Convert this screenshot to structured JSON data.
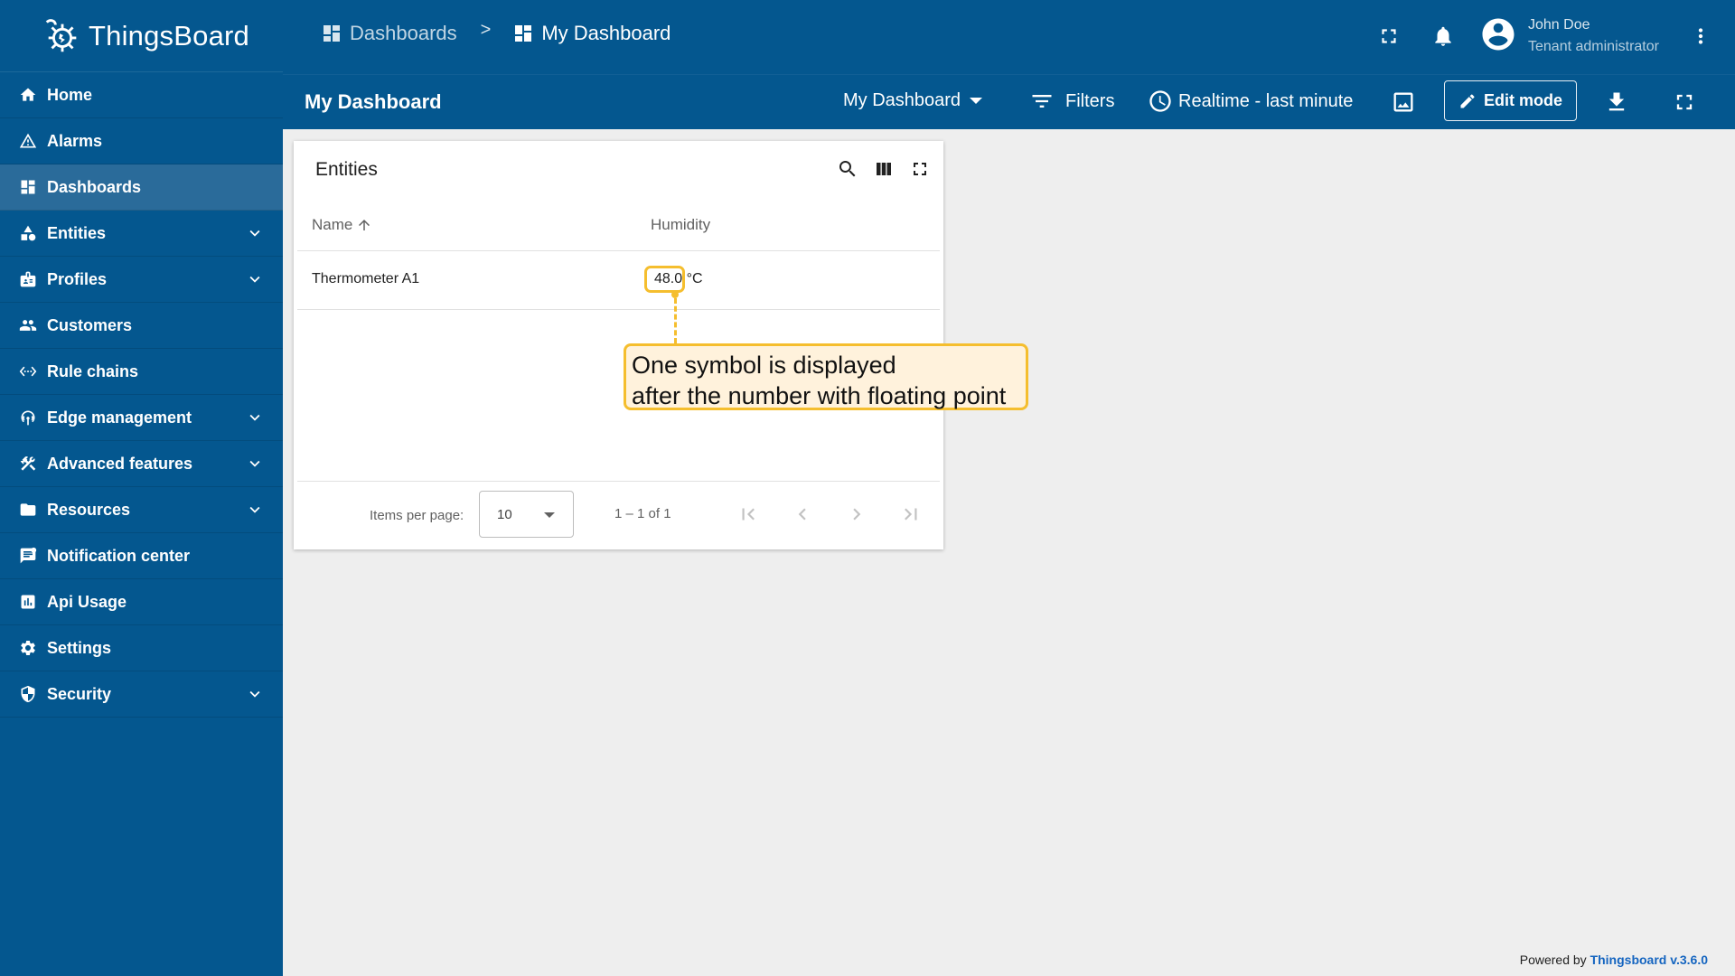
{
  "app": {
    "name": "ThingsBoard"
  },
  "sidebar": {
    "items": [
      {
        "label": "Home",
        "icon": "home-icon",
        "expandable": false
      },
      {
        "label": "Alarms",
        "icon": "warning-icon",
        "expandable": false
      },
      {
        "label": "Dashboards",
        "icon": "dashboard-icon",
        "expandable": false,
        "active": true
      },
      {
        "label": "Entities",
        "icon": "shapes-icon",
        "expandable": true
      },
      {
        "label": "Profiles",
        "icon": "badge-icon",
        "expandable": true
      },
      {
        "label": "Customers",
        "icon": "people-icon",
        "expandable": false
      },
      {
        "label": "Rule chains",
        "icon": "settings-ethernet-icon",
        "expandable": false
      },
      {
        "label": "Edge management",
        "icon": "router-icon",
        "expandable": true
      },
      {
        "label": "Advanced features",
        "icon": "construction-icon",
        "expandable": true
      },
      {
        "label": "Resources",
        "icon": "folder-icon",
        "expandable": true
      },
      {
        "label": "Notification center",
        "icon": "notification-icon",
        "expandable": false
      },
      {
        "label": "Api Usage",
        "icon": "insert-chart-icon",
        "expandable": false
      },
      {
        "label": "Settings",
        "icon": "gear-icon",
        "expandable": false
      },
      {
        "label": "Security",
        "icon": "security-icon",
        "expandable": true
      }
    ]
  },
  "breadcrumb": {
    "first": "Dashboards",
    "separator": ">",
    "current": "My Dashboard"
  },
  "user": {
    "name": "John Doe",
    "role": "Tenant administrator"
  },
  "dashboard_bar": {
    "title": "My Dashboard",
    "selector": "My Dashboard",
    "filters": "Filters",
    "timewindow": "Realtime - last minute",
    "edit_mode": "Edit mode"
  },
  "widget": {
    "title": "Entities",
    "columns": {
      "name": "Name",
      "humidity": "Humidity"
    },
    "rows": [
      {
        "name": "Thermometer A1",
        "humidity": "48.0 °C"
      }
    ],
    "paginator": {
      "label": "Items per page:",
      "page_size": "10",
      "range": "1 – 1 of 1"
    }
  },
  "annotation": {
    "line1": "One symbol is displayed",
    "line2": "after the number with floating point",
    "color": "#f5be2e"
  },
  "footer": {
    "prefix": "Powered by",
    "link": "Thingsboard v.3.6.0"
  },
  "colors": {
    "primary": "#04578f",
    "active_item": "#2a6b9a",
    "background": "#eeeeee"
  }
}
